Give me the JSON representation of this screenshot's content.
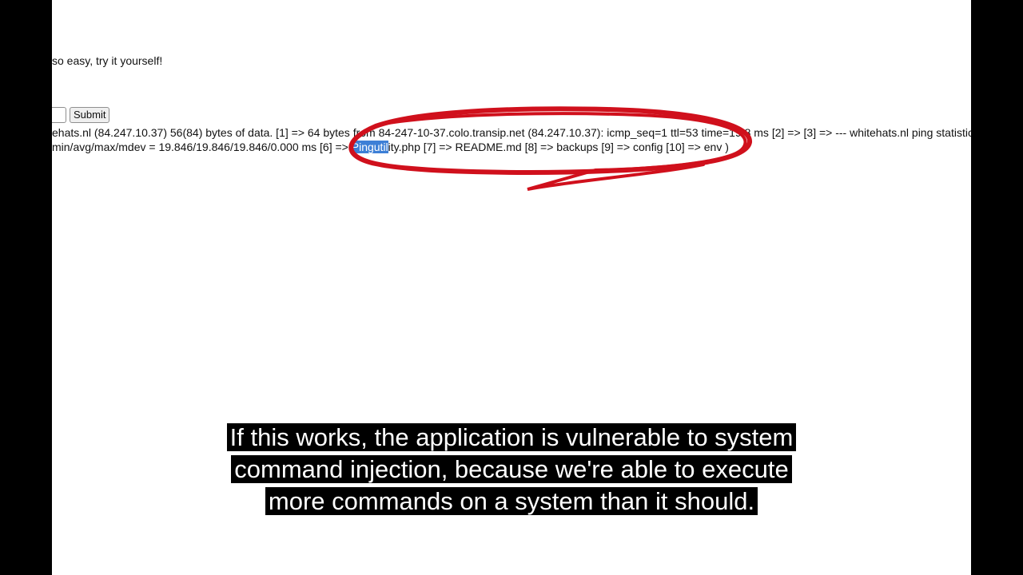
{
  "page": {
    "intro_text": "so easy, try it yourself!",
    "command_input_value": "",
    "submit_label": "Submit",
    "output_line_1": "ehats.nl (84.247.10.37) 56(84) bytes of data. [1] => 64 bytes from 84-247-10-37.colo.transip.net (84.247.10.37): icmp_seq=1 ttl=53 time=19.8 ms [2] => [3] => --- whitehats.nl ping statistics",
    "output_line_2_before": "min/avg/max/mdev = 19.846/19.846/19.846/0.000 ms [6] => ",
    "output_line_2_selected": "Pingutil",
    "output_line_2_after": "ity.php [7] => README.md [8] => backups [9] => config [10] => env )"
  },
  "annotation": {
    "color": "#d0101c",
    "shape": "hand-drawn-ellipse"
  },
  "subtitles": {
    "line_1": "If this works, the application is vulnerable to system",
    "line_2": "command injection, because we're able to execute",
    "line_3": "more commands on a system than it should."
  },
  "colors": {
    "selection": "#3d7fd6",
    "subtitle_background": "#000000",
    "subtitle_text": "#ffffff"
  }
}
